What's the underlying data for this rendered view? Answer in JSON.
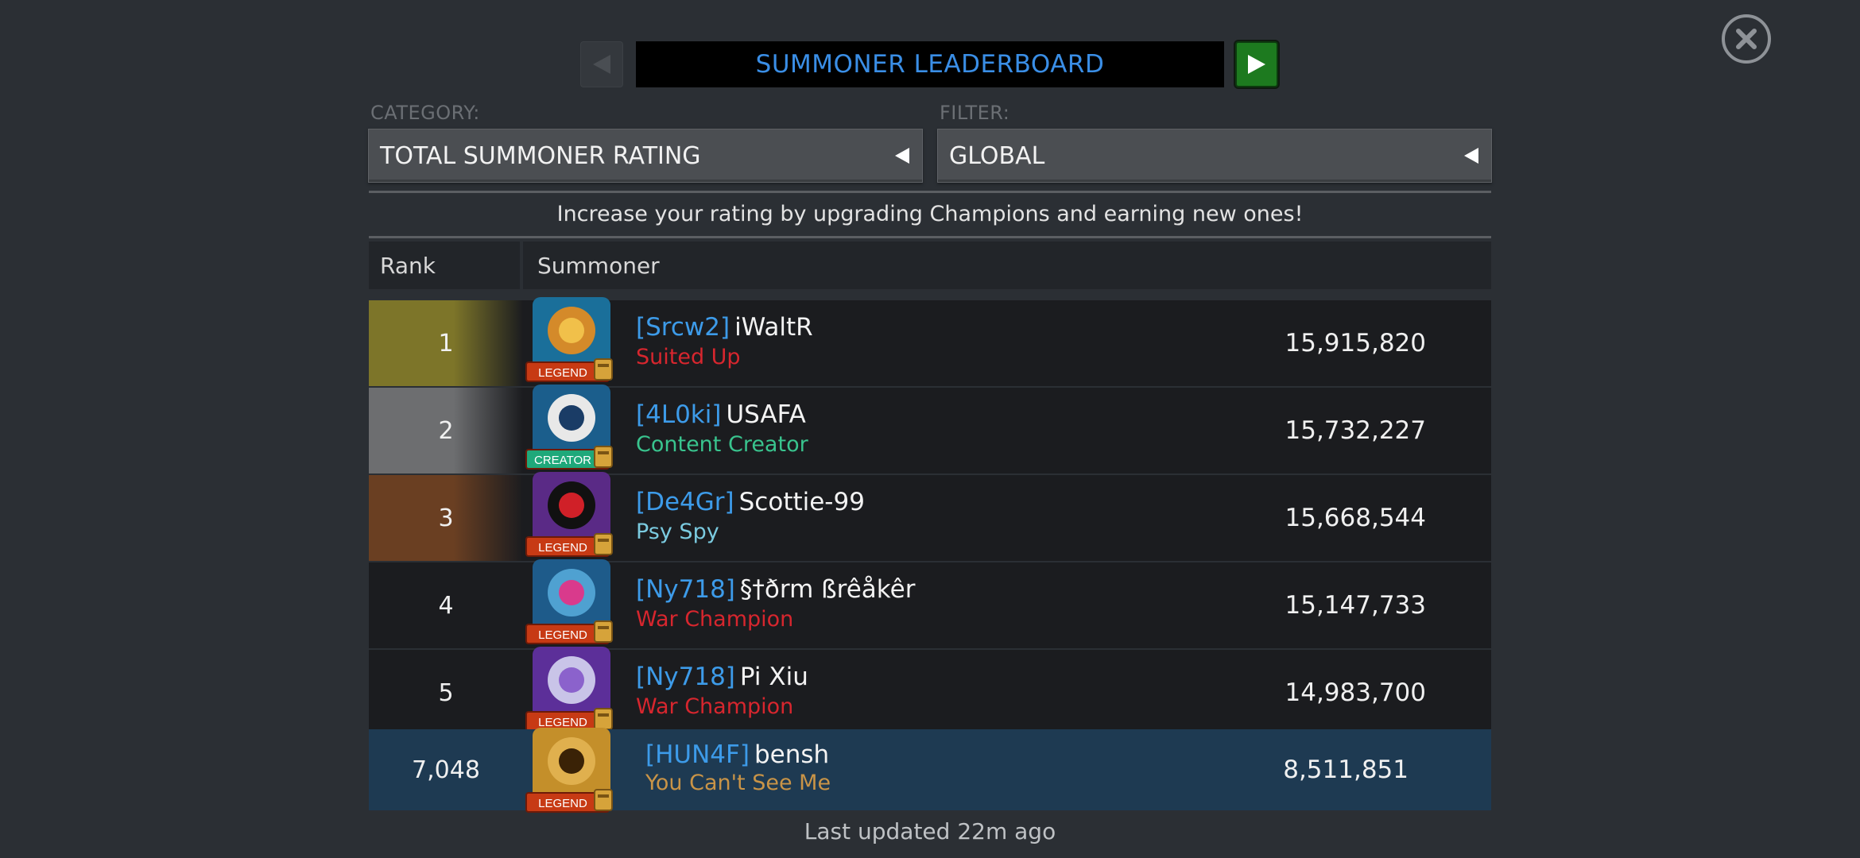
{
  "header": {
    "title": "SUMMONER LEADERBOARD",
    "prev_icon": "left-triangle",
    "next_icon": "right-triangle",
    "close_icon": "close-x"
  },
  "category": {
    "label": "CATEGORY:",
    "value": "TOTAL SUMMONER RATING"
  },
  "filter": {
    "label": "FILTER:",
    "value": "GLOBAL"
  },
  "hint": "Increase your rating by upgrading Champions and earning new ones!",
  "table": {
    "columns": {
      "rank": "Rank",
      "summoner": "Summoner"
    },
    "rows": [
      {
        "rank": "1",
        "alliance": "[Srcw2]",
        "name": "iWaltR",
        "title": "Suited Up",
        "title_color": "#d7262e",
        "rating": "15,915,820",
        "badge": "LEGEND",
        "badge_color": "#c73a14",
        "rank_color": "#7d7529"
      },
      {
        "rank": "2",
        "alliance": "[4L0ki]",
        "name": "USAFA",
        "title": "Content Creator",
        "title_color": "#39c48e",
        "rating": "15,732,227",
        "badge": "CREATOR",
        "badge_color": "#1fa87a",
        "rank_color": "#6d6e70"
      },
      {
        "rank": "3",
        "alliance": "[De4Gr]",
        "name": "Scottie-99",
        "title": "Psy Spy",
        "title_color": "#7bcbe0",
        "rating": "15,668,544",
        "badge": "LEGEND",
        "badge_color": "#c73a14",
        "rank_color": "#6a3f22"
      },
      {
        "rank": "4",
        "alliance": "[Ny718]",
        "name": "§†ðrm ßrêåkêr",
        "title": "War Champion",
        "title_color": "#d7262e",
        "rating": "15,147,733",
        "badge": "LEGEND",
        "badge_color": "#c73a14",
        "rank_color": "#1b1c1f"
      },
      {
        "rank": "5",
        "alliance": "[Ny718]",
        "name": "Pi Xiu",
        "title": "War Champion",
        "title_color": "#d7262e",
        "rating": "14,983,700",
        "badge": "LEGEND",
        "badge_color": "#c73a14",
        "rank_color": "#1b1c1f"
      }
    ],
    "self": {
      "rank": "7,048",
      "alliance": "[HUN4F]",
      "name": "bensh",
      "title": "You Can't See Me",
      "title_color": "#c99447",
      "rating": "8,511,851",
      "badge": "LEGEND",
      "badge_color": "#c73a14"
    }
  },
  "footer": "Last updated 22m ago"
}
